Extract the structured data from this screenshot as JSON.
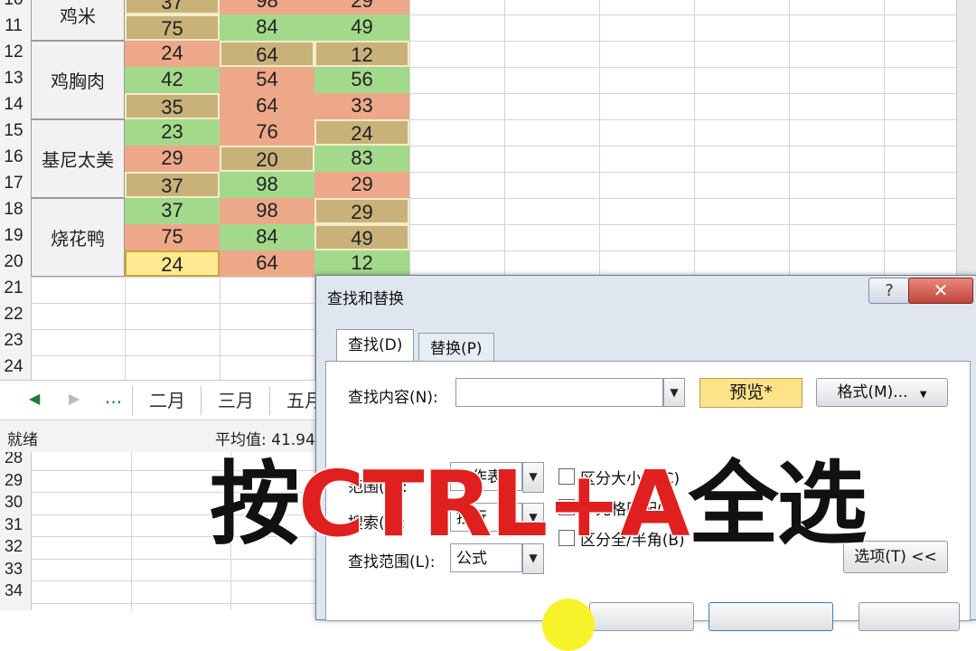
{
  "sheet_top": {
    "row_numbers": [
      "10",
      "11",
      "12",
      "13",
      "14",
      "15",
      "16",
      "17",
      "18",
      "19",
      "20",
      "21",
      "22",
      "23",
      "24"
    ],
    "groups": [
      {
        "name": "鸡米",
        "rows": [
          {
            "b": {
              "v": "37",
              "c": "k"
            },
            "c": {
              "v": "98",
              "c": "o"
            },
            "d": {
              "v": "29",
              "c": "o"
            }
          },
          {
            "b": {
              "v": "75",
              "c": "k"
            },
            "c": {
              "v": "84",
              "c": "g"
            },
            "d": {
              "v": "49",
              "c": "g"
            }
          }
        ]
      },
      {
        "name": "鸡胸肉",
        "rows": [
          {
            "b": {
              "v": "24",
              "c": "o"
            },
            "c": {
              "v": "64",
              "c": "k"
            },
            "d": {
              "v": "12",
              "c": "k"
            }
          },
          {
            "b": {
              "v": "42",
              "c": "g"
            },
            "c": {
              "v": "54",
              "c": "o"
            },
            "d": {
              "v": "56",
              "c": "g"
            }
          },
          {
            "b": {
              "v": "35",
              "c": "k"
            },
            "c": {
              "v": "64",
              "c": "o"
            },
            "d": {
              "v": "33",
              "c": "o"
            }
          }
        ]
      },
      {
        "name": "基尼太美",
        "rows": [
          {
            "b": {
              "v": "23",
              "c": "g"
            },
            "c": {
              "v": "76",
              "c": "o"
            },
            "d": {
              "v": "24",
              "c": "k"
            }
          },
          {
            "b": {
              "v": "29",
              "c": "o"
            },
            "c": {
              "v": "20",
              "c": "k"
            },
            "d": {
              "v": "83",
              "c": "g"
            }
          },
          {
            "b": {
              "v": "37",
              "c": "k"
            },
            "c": {
              "v": "98",
              "c": "g"
            },
            "d": {
              "v": "29",
              "c": "o"
            }
          }
        ]
      },
      {
        "name": "烧花鸭",
        "rows": [
          {
            "b": {
              "v": "37",
              "c": "g"
            },
            "c": {
              "v": "98",
              "c": "o"
            },
            "d": {
              "v": "29",
              "c": "k"
            }
          },
          {
            "b": {
              "v": "75",
              "c": "o"
            },
            "c": {
              "v": "84",
              "c": "g"
            },
            "d": {
              "v": "49",
              "c": "k"
            }
          },
          {
            "b": {
              "v": "24",
              "c": "y"
            },
            "c": {
              "v": "64",
              "c": "o"
            },
            "d": {
              "v": "12",
              "c": "g"
            }
          }
        ]
      }
    ]
  },
  "sheet_tabs": {
    "nav_prev": "◀",
    "nav_next": "▶",
    "more": "...",
    "tabs": [
      "二月",
      "三月",
      "五月"
    ]
  },
  "status": {
    "ready": "就绪",
    "average": "平均值: 41.94"
  },
  "sheet_bottom": {
    "row_numbers": [
      "28",
      "29",
      "30",
      "31",
      "32",
      "33",
      "34"
    ]
  },
  "dialog": {
    "title": "查找和替换",
    "help": "?",
    "close": "✕",
    "tab_find": "查找(D)",
    "tab_replace": "替换(P)",
    "find_label": "查找内容(N):",
    "find_value": "",
    "preview": "预览*",
    "format_btn": "格式(M)...",
    "within_label": "范围(H):",
    "within_value": "工作表",
    "search_label": "搜索(S):",
    "search_value": "按行",
    "lookin_label": "查找范围(L):",
    "lookin_value": "公式",
    "match_case": "区分大小写(C)",
    "match_cell": "单元格匹配(O)",
    "match_width": "区分全/半角(B)",
    "options_btn": "选项(T) <<",
    "dropdown_arrow": "▼"
  },
  "overlay": {
    "part1": "按",
    "part2": "CTRL+A",
    "part3": "全选"
  }
}
